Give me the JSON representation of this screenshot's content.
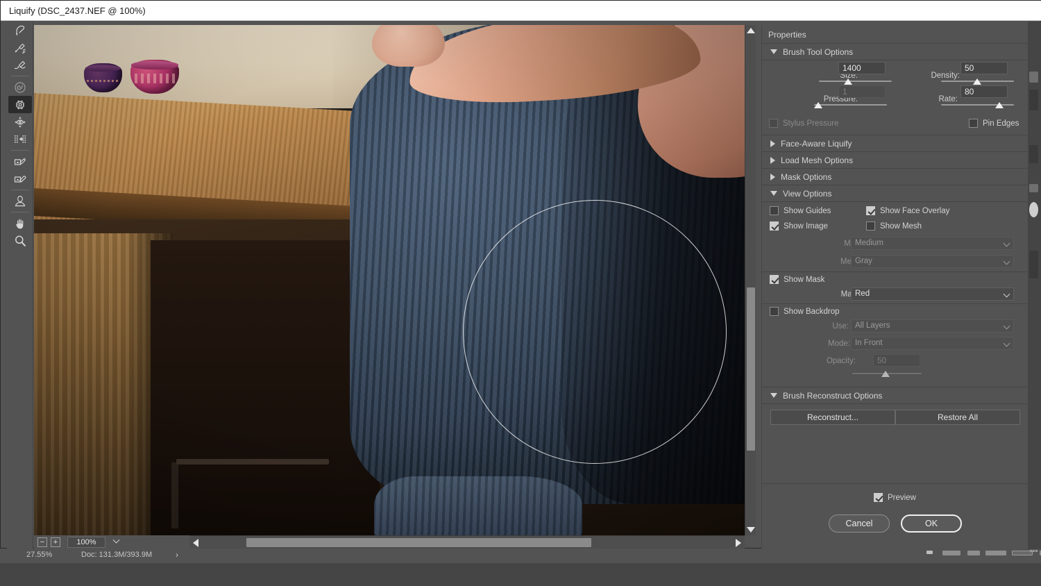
{
  "window": {
    "title": "Liquify (DSC_2437.NEF @ 100%)"
  },
  "toolbar": {
    "tools": [
      {
        "name": "forward-warp-tool",
        "label": "Forward Warp Tool",
        "selected": false
      },
      {
        "name": "reconstruct-tool",
        "label": "Reconstruct Tool",
        "selected": false
      },
      {
        "name": "smooth-tool",
        "label": "Smooth Tool",
        "selected": false
      },
      {
        "name": "twirl-clockwise-tool",
        "label": "Twirl Clockwise Tool",
        "selected": false
      },
      {
        "name": "pucker-tool",
        "label": "Pucker Tool",
        "selected": true
      },
      {
        "name": "bloat-tool",
        "label": "Bloat Tool",
        "selected": false
      },
      {
        "name": "push-left-tool",
        "label": "Push Left Tool",
        "selected": false
      },
      {
        "name": "freeze-mask-tool",
        "label": "Freeze Mask Tool",
        "selected": false
      },
      {
        "name": "thaw-mask-tool",
        "label": "Thaw Mask Tool",
        "selected": false
      },
      {
        "name": "face-tool",
        "label": "Face Tool",
        "selected": false
      },
      {
        "name": "hand-tool",
        "label": "Hand Tool",
        "selected": false
      },
      {
        "name": "zoom-tool",
        "label": "Zoom Tool",
        "selected": false
      }
    ]
  },
  "canvas": {
    "zoom_level": "100%",
    "zoom_out_label": "−",
    "zoom_in_label": "+"
  },
  "properties": {
    "panel_title": "Properties",
    "brush_tool_options": {
      "title": "Brush Tool Options",
      "size_label": "Size:",
      "size_value": "1400",
      "size_slider_pct": 40,
      "density_label": "Density:",
      "density_value": "50",
      "density_slider_pct": 50,
      "pressure_label": "Pressure:",
      "pressure_value": "1",
      "pressure_slider_pct": 3,
      "rate_label": "Rate:",
      "rate_value": "80",
      "rate_slider_pct": 78,
      "stylus_pressure_label": "Stylus Pressure",
      "stylus_pressure_checked": false,
      "pin_edges_label": "Pin Edges",
      "pin_edges_checked": false
    },
    "face_aware_liquify": {
      "title": "Face-Aware Liquify",
      "expanded": false
    },
    "load_mesh_options": {
      "title": "Load Mesh Options",
      "expanded": false
    },
    "mask_options": {
      "title": "Mask Options",
      "expanded": false
    },
    "view_options": {
      "title": "View Options",
      "expanded": true,
      "show_guides_label": "Show Guides",
      "show_guides_checked": false,
      "show_face_overlay_label": "Show Face Overlay",
      "show_face_overlay_checked": true,
      "show_image_label": "Show Image",
      "show_image_checked": true,
      "show_mesh_label": "Show Mesh",
      "show_mesh_checked": false,
      "mesh_size_label": "Mesh Size:",
      "mesh_size_value": "Medium",
      "mesh_color_label": "Mesh Color:",
      "mesh_color_value": "Gray",
      "show_mask_label": "Show Mask",
      "show_mask_checked": true,
      "mask_color_label": "Mask Color:",
      "mask_color_value": "Red",
      "show_backdrop_label": "Show Backdrop",
      "show_backdrop_checked": false,
      "use_label": "Use:",
      "use_value": "All Layers",
      "mode_label": "Mode:",
      "mode_value": "In Front",
      "opacity_label": "Opacity:",
      "opacity_value": "50",
      "opacity_slider_pct": 48
    },
    "brush_reconstruct_options": {
      "title": "Brush Reconstruct Options",
      "expanded": true,
      "reconstruct_label": "Reconstruct...",
      "restore_all_label": "Restore All"
    },
    "footer": {
      "preview_label": "Preview",
      "preview_checked": true,
      "cancel_label": "Cancel",
      "ok_label": "OK"
    }
  },
  "status_bar": {
    "zoom_percent": "27.55%",
    "doc_info": "Doc: 131.3M/393.9M",
    "arrow": "›"
  },
  "colors": {
    "panel_bg": "#535353",
    "field_bg": "#454545",
    "title_bar": "#ffffff",
    "text": "#d4d4d4",
    "accent_outline": "#f0f0f0"
  }
}
